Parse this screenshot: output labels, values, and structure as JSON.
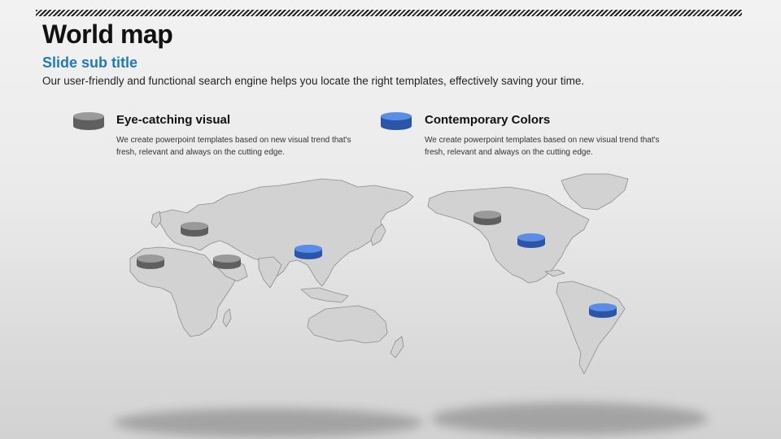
{
  "slide": {
    "title": "World map",
    "subtitle": "Slide sub title",
    "description": "Our user-friendly and functional search engine helps you locate the right templates, effectively saving your time."
  },
  "features": [
    {
      "title": "Eye-catching visual",
      "text": "We create powerpoint templates based on new visual trend that's fresh, relevant and always on the cutting edge.",
      "color": "#6e6e6e"
    },
    {
      "title": "Contemporary Colors",
      "text": "We create powerpoint templates based on new visual trend that's fresh, relevant and always on the cutting edge.",
      "color": "#3a6fd0"
    }
  ],
  "colors": {
    "accent_blue": "#1f7ab8",
    "marker_gray": "#6e6e6e",
    "marker_blue": "#3a6fd0",
    "map_fill": "#cfcfcf"
  }
}
